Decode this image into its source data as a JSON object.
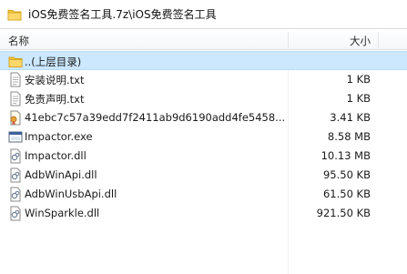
{
  "window": {
    "path": "iOS免费签名工具.7z\\iOS免费签名工具",
    "folder_icon": "folder-icon"
  },
  "columns": {
    "name": "名称",
    "size": "大小"
  },
  "files": [
    {
      "name": "..(上层目录)",
      "size": "",
      "icon": "folder-up-icon"
    },
    {
      "name": "安装说明.txt",
      "size": "1 KB",
      "icon": "text-file-icon"
    },
    {
      "name": "免责声明.txt",
      "size": "1 KB",
      "icon": "text-file-icon"
    },
    {
      "name": "41ebc7c57a39edd7f2411ab9d6190add4fe5458...",
      "size": "3.41 KB",
      "icon": "certificate-file-icon"
    },
    {
      "name": "Impactor.exe",
      "size": "8.58 MB",
      "icon": "exe-file-icon"
    },
    {
      "name": "Impactor.dll",
      "size": "10.13 MB",
      "icon": "dll-file-icon"
    },
    {
      "name": "AdbWinApi.dll",
      "size": "95.50 KB",
      "icon": "dll-file-icon"
    },
    {
      "name": "AdbWinUsbApi.dll",
      "size": "61.50 KB",
      "icon": "dll-file-icon"
    },
    {
      "name": "WinSparkle.dll",
      "size": "921.50 KB",
      "icon": "dll-file-icon"
    }
  ],
  "colors": {
    "selected_row": "#cce8ff",
    "folder": "#f5c542"
  }
}
